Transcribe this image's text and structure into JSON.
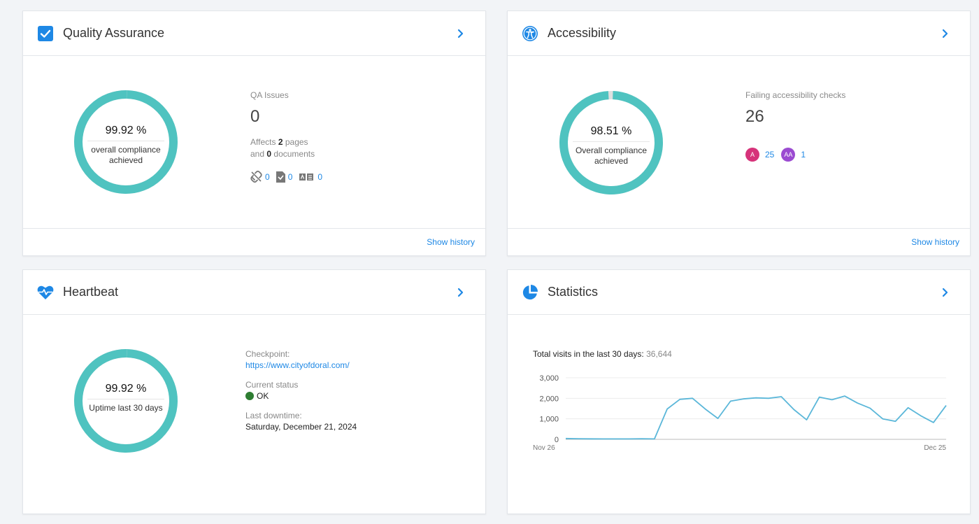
{
  "qa": {
    "title": "Quality Assurance",
    "percent": "99.92 %",
    "compliance_line1": "overall compliance",
    "compliance_line2": "achieved",
    "compliance_fraction": 0.9992,
    "issues_label": "QA Issues",
    "issues_count": "0",
    "affects_prefix": "Affects",
    "affects_pages": "2",
    "affects_pages_suffix": "pages",
    "and_label": "and",
    "affects_docs": "0",
    "affects_docs_suffix": "documents",
    "broken_links": "0",
    "misspellings": "0",
    "readability": "0",
    "show_history": "Show history"
  },
  "accessibility": {
    "title": "Accessibility",
    "percent": "98.51 %",
    "compliance_line1": "Overall compliance",
    "compliance_line2": "achieved",
    "compliance_fraction": 0.9851,
    "failing_label": "Failing accessibility checks",
    "failing_count": "26",
    "level_a_badge": "A",
    "level_a_count": "25",
    "level_aa_badge": "AA",
    "level_aa_count": "1",
    "level_a_color": "#d6337a",
    "level_aa_color": "#9b4bd1",
    "show_history": "Show history"
  },
  "heartbeat": {
    "title": "Heartbeat",
    "percent": "99.92 %",
    "uptime_label": "Uptime last 30 days",
    "uptime_fraction": 0.9992,
    "checkpoint_label": "Checkpoint:",
    "checkpoint_url": "https://www.cityofdoral.com/",
    "status_label": "Current status",
    "status_value": "OK",
    "status_color": "#2e7d32",
    "last_downtime_label": "Last downtime:",
    "last_downtime_value": "Saturday, December 21, 2024"
  },
  "statistics": {
    "title": "Statistics",
    "visits_label": "Total visits in the last 30 days:",
    "visits_value": "36,644"
  },
  "colors": {
    "accent": "#1e88e5",
    "donut": "#4fc3c0",
    "donut_gap": "#e0e0e0",
    "line": "#5bb7d9"
  },
  "chart_data": {
    "type": "line",
    "x_start_label": "Nov 26",
    "x_end_label": "Dec 25",
    "ylim": [
      0,
      3000
    ],
    "y_ticks": [
      "0",
      "1,000",
      "2,000",
      "3,000"
    ],
    "y_tick_values": [
      0,
      1000,
      2000,
      3000
    ],
    "grid": true,
    "values": [
      40,
      30,
      25,
      20,
      20,
      20,
      30,
      20,
      1480,
      1950,
      2000,
      1480,
      1020,
      1860,
      1970,
      2020,
      2000,
      2080,
      1450,
      950,
      2060,
      1930,
      2110,
      1770,
      1520,
      1000,
      880,
      1540,
      1150,
      820,
      1650
    ]
  }
}
